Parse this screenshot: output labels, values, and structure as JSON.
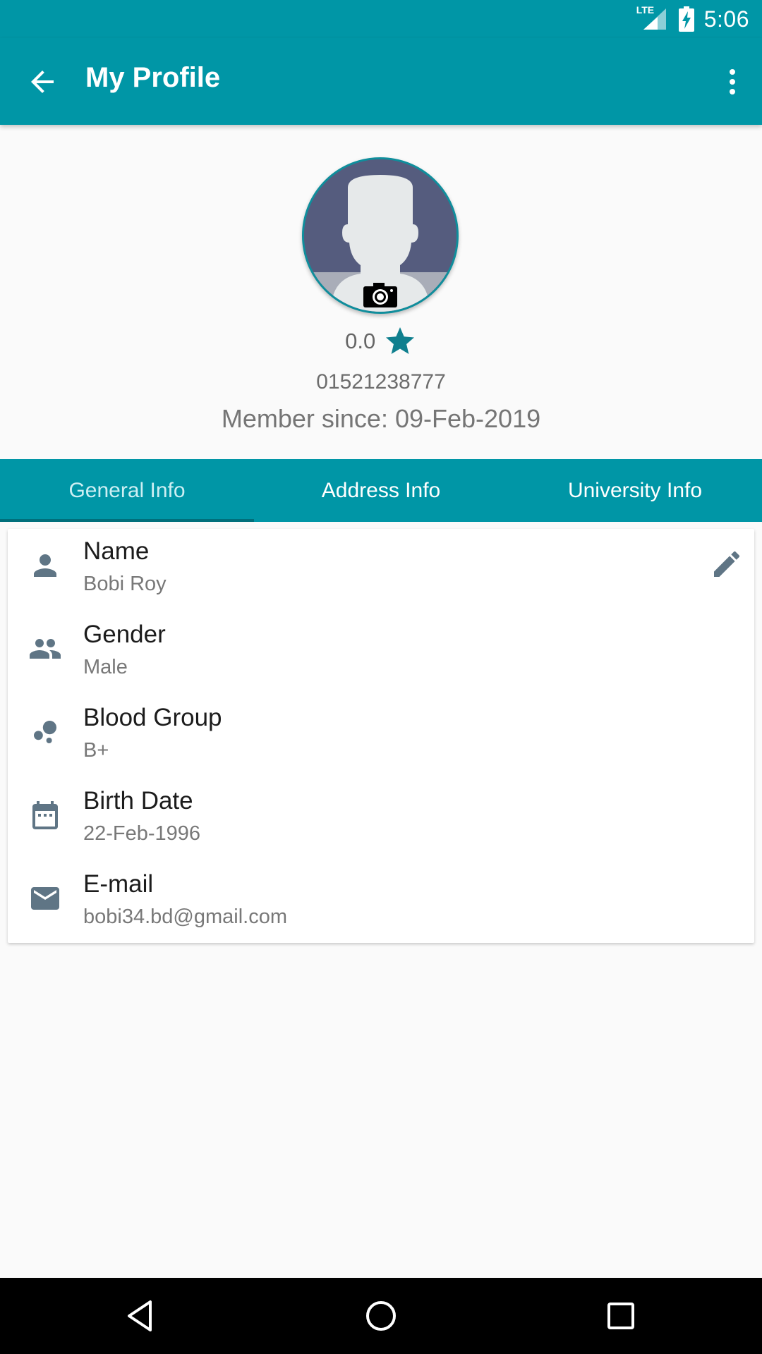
{
  "status_bar": {
    "time": "5:06",
    "network": "LTE"
  },
  "app_bar": {
    "title": "My Profile"
  },
  "profile": {
    "rating": "0.0",
    "phone": "01521238777",
    "member_since_label": "Member since:",
    "member_since_date": "09-Feb-2019"
  },
  "tabs": [
    {
      "label": "General Info",
      "active": true
    },
    {
      "label": "Address Info",
      "active": false
    },
    {
      "label": "University Info",
      "active": false
    }
  ],
  "general_info": [
    {
      "label": "Name",
      "value": "Bobi Roy",
      "icon": "person-icon"
    },
    {
      "label": "Gender",
      "value": "Male",
      "icon": "people-icon"
    },
    {
      "label": "Blood Group",
      "value": "B+",
      "icon": "bubble-chart-icon"
    },
    {
      "label": "Birth Date",
      "value": "22-Feb-1996",
      "icon": "calendar-icon"
    },
    {
      "label": "E-mail",
      "value": "bobi34.bd@gmail.com",
      "icon": "mail-icon"
    }
  ],
  "colors": {
    "primary": "#0096a6",
    "tab_indicator": "#006f7b",
    "icon_gray": "#5f7585",
    "star": "#0f7f8e"
  }
}
